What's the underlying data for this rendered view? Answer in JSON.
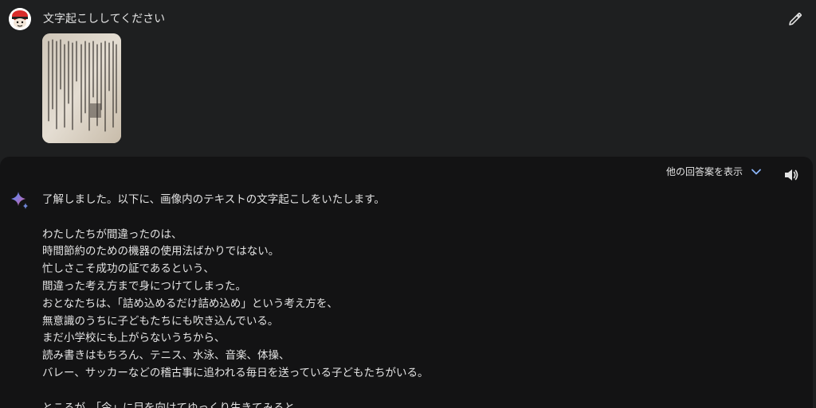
{
  "user": {
    "prompt": "文字起こししてください",
    "attachment_icon": "book-page-photo"
  },
  "toolbar": {
    "edit_icon": "pencil-icon"
  },
  "response": {
    "show_drafts_label": "他の回答案を表示",
    "drafts_icon": "chevron-down-icon",
    "speaker_icon": "speaker-icon",
    "model_icon": "gemini-sparkle-icon",
    "intro": "了解しました。以下に、画像内のテキストの文字起こしをいたします。",
    "lines": [
      "わたしたちが間違ったのは、",
      "時間節約のための機器の使用法ばかりではない。",
      "忙しさこそ成功の証であるという、",
      "間違った考え方まで身につけてしまった。",
      "おとなたちは、「詰め込めるだけ詰め込め」という考え方を、",
      "無意識のうちに子どもたちにも吹き込んでいる。",
      "まだ小学校にも上がらないうちから、",
      "読み書きはもちろん、テニス、水泳、音楽、体操、",
      "バレー、サッカーなどの稽古事に追われる毎日を送っている子どもたちがいる。"
    ],
    "partial_line": "ところが、「今」に目を向けてゆっくり生きてみると、"
  },
  "colors": {
    "background": "#1e1f20",
    "card": "#131314",
    "text": "#e3e3e3",
    "accent": "#8ab4f8"
  }
}
